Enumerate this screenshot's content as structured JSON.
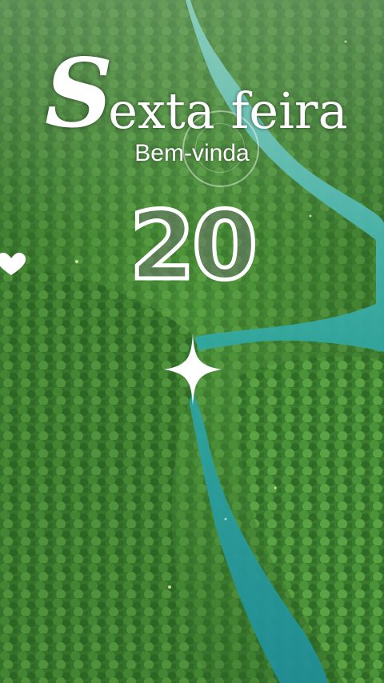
{
  "title": {
    "initial": "S",
    "rest": "exta feira"
  },
  "subtitle": "Bem-vinda",
  "day_number": "20",
  "colors": {
    "forest": "#2f6b2a",
    "river": "#3fb6b0",
    "text": "#ffffff"
  },
  "icons": [
    "heart-icon",
    "sparkle-icon"
  ]
}
